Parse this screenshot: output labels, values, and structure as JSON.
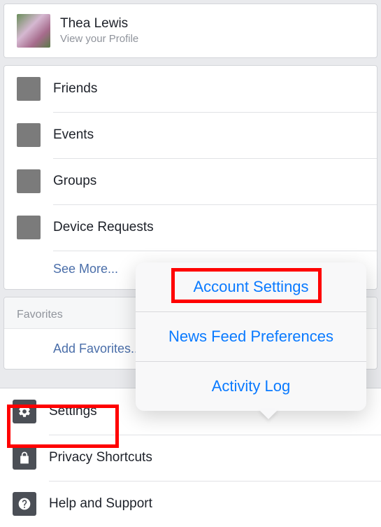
{
  "profile": {
    "name": "Thea Lewis",
    "subtitle": "View your Profile"
  },
  "nav": {
    "items": [
      {
        "label": "Friends"
      },
      {
        "label": "Events"
      },
      {
        "label": "Groups"
      },
      {
        "label": "Device Requests"
      }
    ],
    "see_more": "See More..."
  },
  "favorites": {
    "header": "Favorites",
    "add_label": "Add Favorites..."
  },
  "bottom": {
    "items": [
      {
        "label": "Settings",
        "icon": "gear"
      },
      {
        "label": "Privacy Shortcuts",
        "icon": "lock"
      },
      {
        "label": "Help and Support",
        "icon": "question"
      }
    ]
  },
  "popover": {
    "items": [
      {
        "label": "Account Settings"
      },
      {
        "label": "News Feed Preferences"
      },
      {
        "label": "Activity Log"
      }
    ]
  }
}
